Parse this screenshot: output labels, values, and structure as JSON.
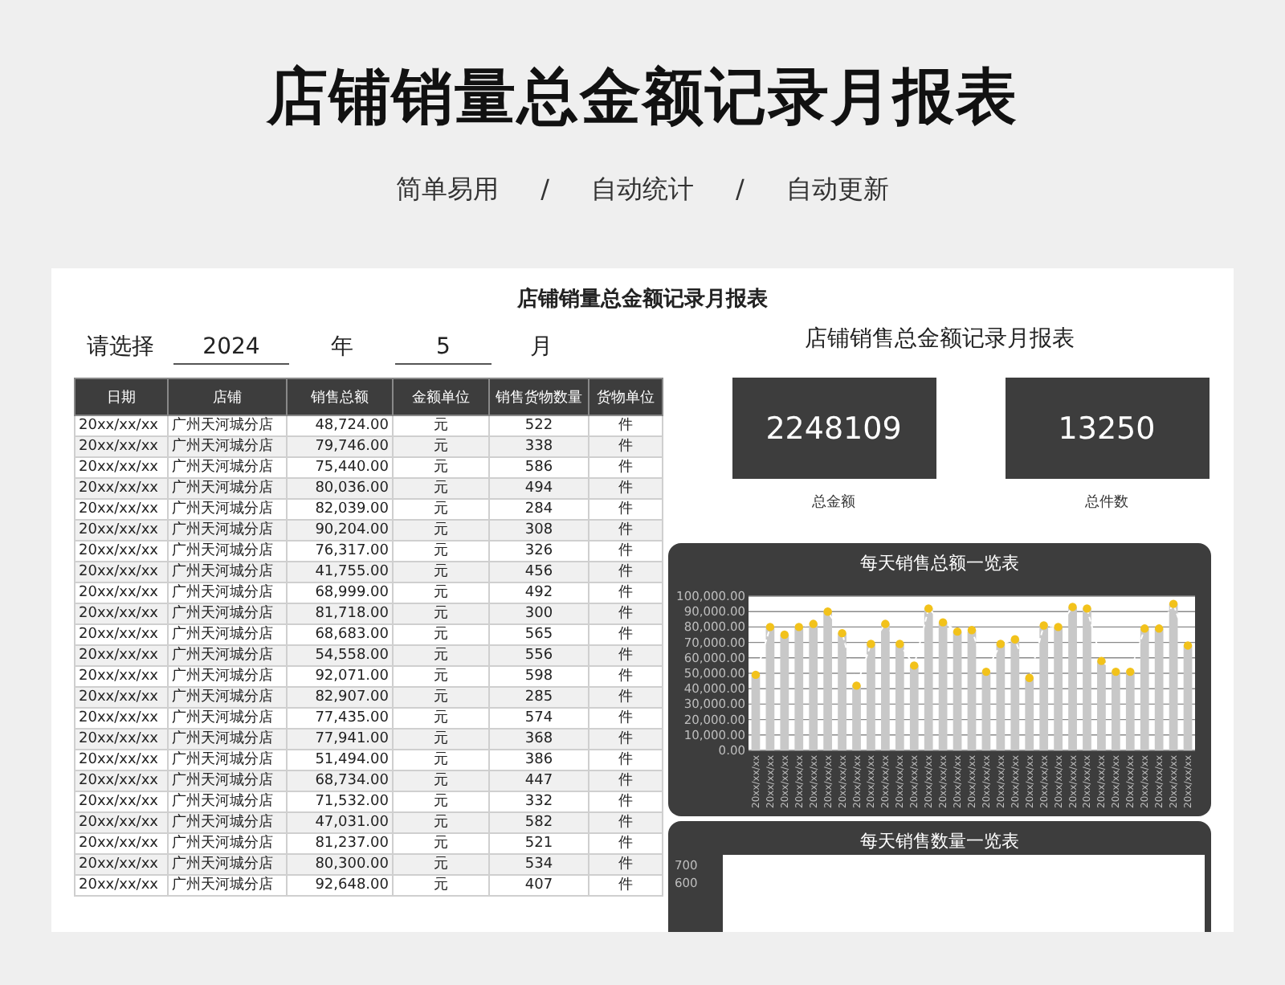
{
  "title": "店铺销量总金额记录月报表",
  "tagline": [
    "简单易用",
    "/",
    "自动统计",
    "/",
    "自动更新"
  ],
  "report": {
    "title": "店铺销量总金额记录月报表",
    "selector": {
      "prompt": "请选择",
      "year": "2024",
      "year_label": "年",
      "month": "5",
      "month_label": "月"
    },
    "right_title": "店铺销售总金额记录月报表",
    "table": {
      "columns": [
        "日期",
        "店铺",
        "销售总额",
        "金额单位",
        "销售货物数量",
        "货物单位"
      ],
      "rows": [
        [
          "20xx/xx/xx",
          "广州天河城分店",
          "48,724.00",
          "元",
          "522",
          "件"
        ],
        [
          "20xx/xx/xx",
          "广州天河城分店",
          "79,746.00",
          "元",
          "338",
          "件"
        ],
        [
          "20xx/xx/xx",
          "广州天河城分店",
          "75,440.00",
          "元",
          "586",
          "件"
        ],
        [
          "20xx/xx/xx",
          "广州天河城分店",
          "80,036.00",
          "元",
          "494",
          "件"
        ],
        [
          "20xx/xx/xx",
          "广州天河城分店",
          "82,039.00",
          "元",
          "284",
          "件"
        ],
        [
          "20xx/xx/xx",
          "广州天河城分店",
          "90,204.00",
          "元",
          "308",
          "件"
        ],
        [
          "20xx/xx/xx",
          "广州天河城分店",
          "76,317.00",
          "元",
          "326",
          "件"
        ],
        [
          "20xx/xx/xx",
          "广州天河城分店",
          "41,755.00",
          "元",
          "456",
          "件"
        ],
        [
          "20xx/xx/xx",
          "广州天河城分店",
          "68,999.00",
          "元",
          "492",
          "件"
        ],
        [
          "20xx/xx/xx",
          "广州天河城分店",
          "81,718.00",
          "元",
          "300",
          "件"
        ],
        [
          "20xx/xx/xx",
          "广州天河城分店",
          "68,683.00",
          "元",
          "565",
          "件"
        ],
        [
          "20xx/xx/xx",
          "广州天河城分店",
          "54,558.00",
          "元",
          "556",
          "件"
        ],
        [
          "20xx/xx/xx",
          "广州天河城分店",
          "92,071.00",
          "元",
          "598",
          "件"
        ],
        [
          "20xx/xx/xx",
          "广州天河城分店",
          "82,907.00",
          "元",
          "285",
          "件"
        ],
        [
          "20xx/xx/xx",
          "广州天河城分店",
          "77,435.00",
          "元",
          "574",
          "件"
        ],
        [
          "20xx/xx/xx",
          "广州天河城分店",
          "77,941.00",
          "元",
          "368",
          "件"
        ],
        [
          "20xx/xx/xx",
          "广州天河城分店",
          "51,494.00",
          "元",
          "386",
          "件"
        ],
        [
          "20xx/xx/xx",
          "广州天河城分店",
          "68,734.00",
          "元",
          "447",
          "件"
        ],
        [
          "20xx/xx/xx",
          "广州天河城分店",
          "71,532.00",
          "元",
          "332",
          "件"
        ],
        [
          "20xx/xx/xx",
          "广州天河城分店",
          "47,031.00",
          "元",
          "582",
          "件"
        ],
        [
          "20xx/xx/xx",
          "广州天河城分店",
          "81,237.00",
          "元",
          "521",
          "件"
        ],
        [
          "20xx/xx/xx",
          "广州天河城分店",
          "80,300.00",
          "元",
          "534",
          "件"
        ],
        [
          "20xx/xx/xx",
          "广州天河城分店",
          "92,648.00",
          "元",
          "407",
          "件"
        ]
      ]
    },
    "kpis": [
      {
        "value": "2248109",
        "label": "总金额"
      },
      {
        "value": "13250",
        "label": "总件数"
      }
    ],
    "amount_chart": {
      "title": "每天销售总额一览表",
      "chart_data": {
        "type": "bar",
        "categories": [
          "20xx/xx/xx",
          "20xx/xx/xx",
          "20xx/xx/xx",
          "20xx/xx/xx",
          "20xx/xx/xx",
          "20xx/xx/xx",
          "20xx/xx/xx",
          "20xx/xx/xx",
          "20xx/xx/xx",
          "20xx/xx/xx",
          "20xx/xx/xx",
          "20xx/xx/xx",
          "20xx/xx/xx",
          "20xx/xx/xx",
          "20xx/xx/xx",
          "20xx/xx/xx",
          "20xx/xx/xx",
          "20xx/xx/xx",
          "20xx/xx/xx",
          "20xx/xx/xx",
          "20xx/xx/xx",
          "20xx/xx/xx",
          "20xx/xx/xx",
          "20xx/xx/xx",
          "20xx/xx/xx",
          "20xx/xx/xx",
          "20xx/xx/xx",
          "20xx/xx/xx",
          "20xx/xx/xx",
          "20xx/xx/xx",
          "20xx/xx/xx"
        ],
        "series": [
          {
            "type": "bar",
            "color": "#c8c8c8",
            "values": [
              49000,
              80000,
              75000,
              80000,
              82000,
              90000,
              76000,
              42000,
              69000,
              82000,
              69000,
              55000,
              92000,
              83000,
              77000,
              78000,
              51000,
              69000,
              72000,
              47000,
              81000,
              80000,
              93000,
              92000,
              58000,
              51000,
              51000,
              79000,
              79000,
              95000,
              68000
            ]
          },
          {
            "type": "line",
            "color": "#f2c21b",
            "line_style": "dashed",
            "marker": "circle",
            "values": [
              49000,
              80000,
              75000,
              80000,
              82000,
              90000,
              76000,
              42000,
              69000,
              82000,
              69000,
              55000,
              92000,
              83000,
              77000,
              78000,
              51000,
              69000,
              72000,
              47000,
              81000,
              80000,
              93000,
              92000,
              58000,
              51000,
              51000,
              79000,
              79000,
              95000,
              68000
            ]
          }
        ],
        "grid": true,
        "stacked": false,
        "ylim": [
          0,
          100000
        ],
        "yticks": [
          {
            "value": 0,
            "label": "0.00"
          },
          {
            "value": 10000,
            "label": "10,000.00"
          },
          {
            "value": 20000,
            "label": "20,000.00"
          },
          {
            "value": 30000,
            "label": "30,000.00"
          },
          {
            "value": 40000,
            "label": "40,000.00"
          },
          {
            "value": 50000,
            "label": "50,000.00"
          },
          {
            "value": 60000,
            "label": "60,000.00"
          },
          {
            "value": 70000,
            "label": "70,000.00"
          },
          {
            "value": 80000,
            "label": "80,000.00"
          },
          {
            "value": 90000,
            "label": "90,000.00"
          },
          {
            "value": 100000,
            "label": "100,000.00"
          }
        ]
      }
    },
    "quantity_chart": {
      "title": "每天销售数量一览表",
      "ytick_labels": [
        "700",
        "600"
      ]
    }
  }
}
